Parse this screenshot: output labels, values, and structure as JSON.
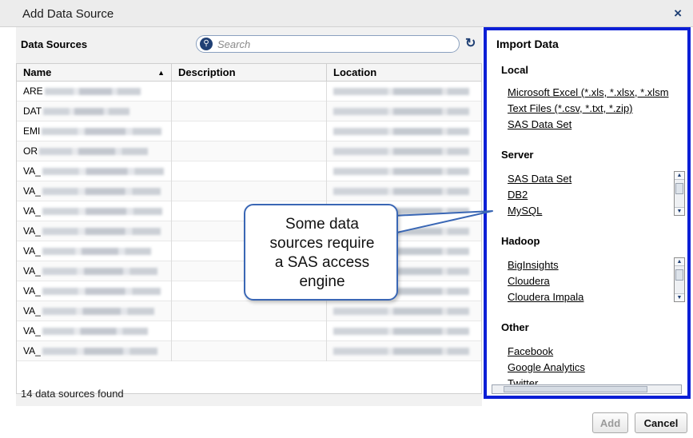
{
  "dialog": {
    "title": "Add Data Source",
    "close_glyph": "×"
  },
  "data_sources": {
    "title": "Data Sources",
    "search_placeholder": "Search",
    "columns": {
      "name": "Name",
      "description": "Description",
      "location": "Location"
    },
    "rows": [
      {
        "name": "ARE"
      },
      {
        "name": "DAT"
      },
      {
        "name": "EMI"
      },
      {
        "name": "OR"
      },
      {
        "name": "VA_"
      },
      {
        "name": "VA_"
      },
      {
        "name": "VA_"
      },
      {
        "name": "VA_"
      },
      {
        "name": "VA_"
      },
      {
        "name": "VA_"
      },
      {
        "name": "VA_"
      },
      {
        "name": "VA_"
      },
      {
        "name": "VA_"
      },
      {
        "name": "VA_"
      }
    ],
    "count_text": "14 data sources found"
  },
  "import_data": {
    "title": "Import Data",
    "local": {
      "heading": "Local",
      "items": [
        "Microsoft Excel (*.xls, *.xlsx, *.xlsm",
        "Text Files (*.csv, *.txt, *.zip)",
        "SAS Data Set"
      ]
    },
    "server": {
      "heading": "Server",
      "items": [
        "SAS Data Set",
        "DB2",
        "MySQL"
      ]
    },
    "hadoop": {
      "heading": "Hadoop",
      "items": [
        "BigInsights",
        "Cloudera",
        "Cloudera Impala"
      ]
    },
    "other": {
      "heading": "Other",
      "items": [
        "Facebook",
        "Google Analytics",
        "Twitter"
      ]
    }
  },
  "callout": {
    "line1": "Some data",
    "line2": "sources require",
    "line3": "a SAS access",
    "line4": "engine"
  },
  "buttons": {
    "add": "Add",
    "cancel": "Cancel"
  },
  "colors": {
    "highlight_border": "#0b1fd6",
    "callout_border": "#3a67b5",
    "icon_blue": "#1f3f74"
  }
}
